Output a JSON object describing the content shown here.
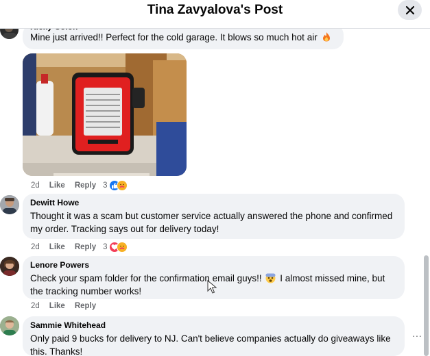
{
  "header": {
    "title": "Tina Zavyalova's Post"
  },
  "comments": [
    {
      "name": "Ricky Colon",
      "text": "Mine just arrived!! Perfect for the cold garage. It blows so much hot air",
      "time": "2d",
      "like": "Like",
      "reply": "Reply",
      "reactions": "3"
    },
    {
      "name": "Dewitt Howe",
      "text": "Thought it was a scam but customer service actually answered the phone and confirmed my order. Tracking says out for delivery today!",
      "time": "2d",
      "like": "Like",
      "reply": "Reply",
      "reactions": "3"
    },
    {
      "name": "Lenore Powers",
      "text_a": "Check your spam folder for the confirmation email guys!!",
      "text_b": "I almost missed mine, but the tracking number works!",
      "time": "2d",
      "like": "Like",
      "reply": "Reply"
    },
    {
      "name": "Sammie Whitehead",
      "text": "Only paid 9 bucks for delivery to NJ. Can't believe companies actually do giveaways like this. Thanks!"
    }
  ],
  "more": "···",
  "icons": [
    "close-icon",
    "fire-emoji",
    "like-reaction-icon",
    "care-reaction-icon",
    "love-reaction-icon",
    "scared-emoji",
    "more-options-icon"
  ]
}
